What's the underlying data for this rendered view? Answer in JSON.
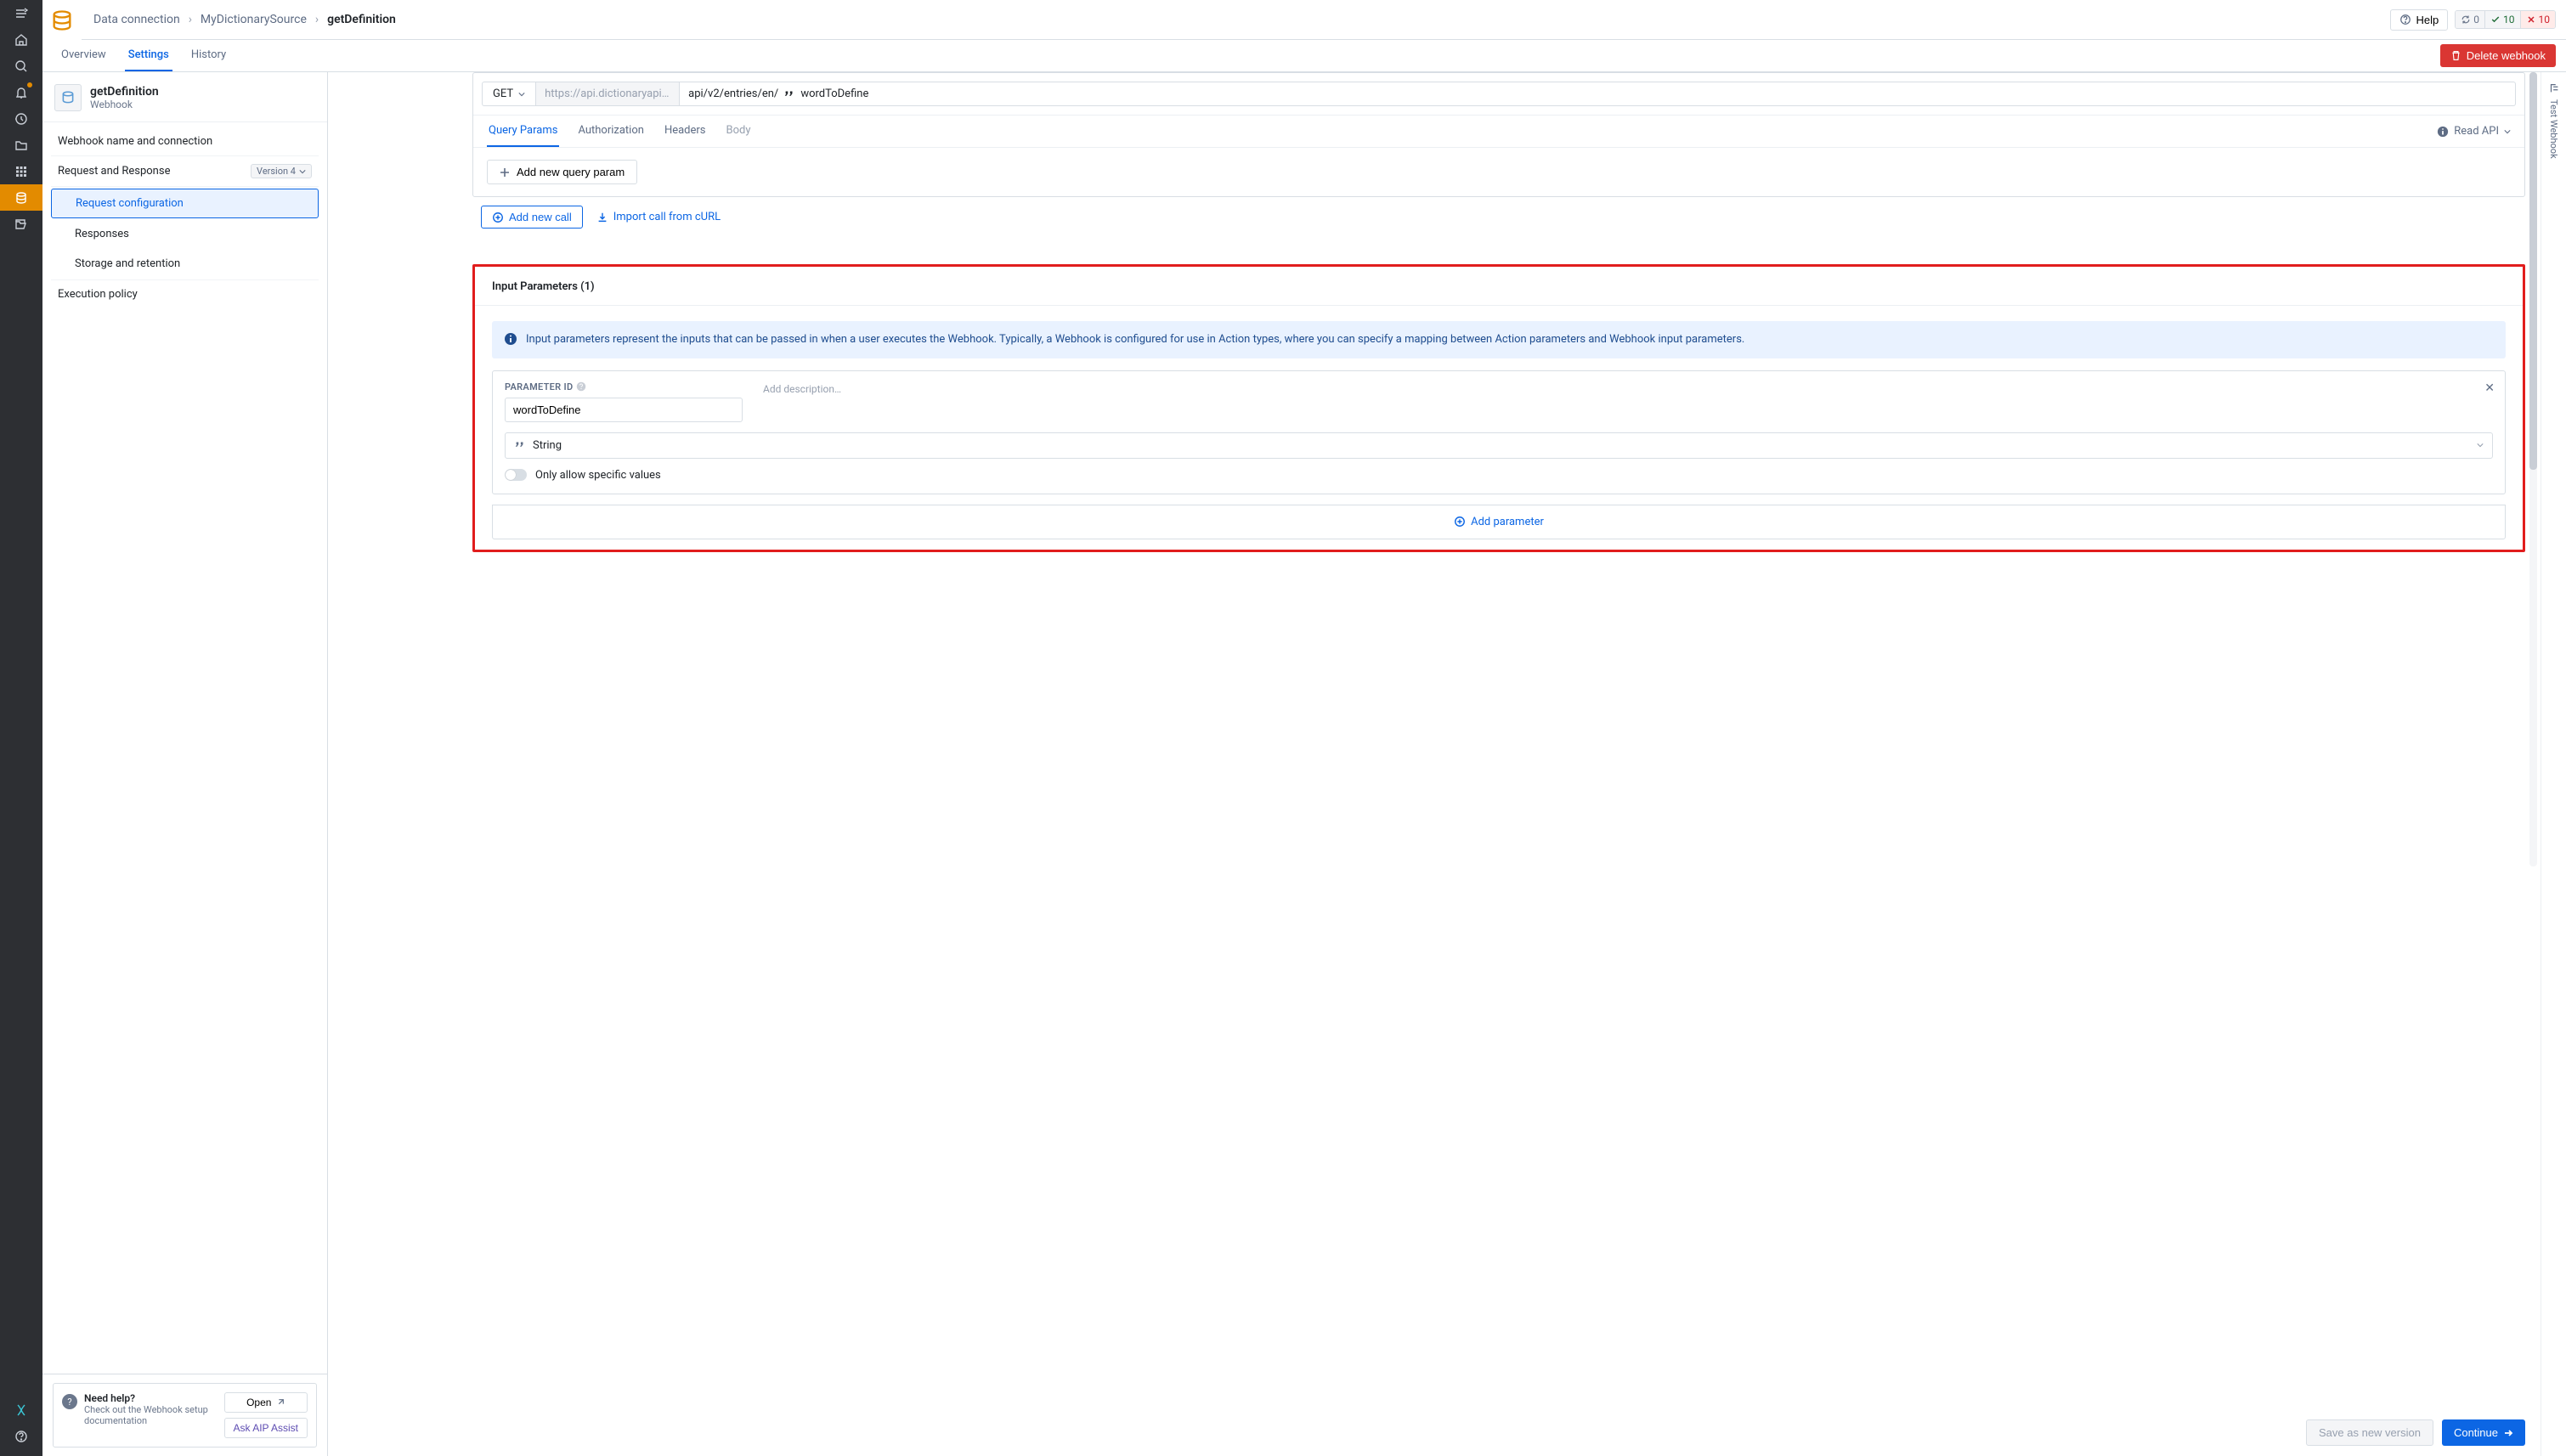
{
  "breadcrumb": {
    "root": "Data connection",
    "source": "MyDictionarySource",
    "leaf": "getDefinition"
  },
  "topbar": {
    "help": "Help",
    "refresh_count": "0",
    "ok_count": "10",
    "err_count": "10"
  },
  "tabs": {
    "overview": "Overview",
    "settings": "Settings",
    "history": "History"
  },
  "delete_label": "Delete webhook",
  "sidebar": {
    "title": "getDefinition",
    "subtitle": "Webhook",
    "items": {
      "name_conn": "Webhook name and connection",
      "req_resp": "Request and Response",
      "version": "Version 4",
      "request_config": "Request configuration",
      "responses": "Responses",
      "storage": "Storage and retention",
      "exec_policy": "Execution policy"
    },
    "help": {
      "title": "Need help?",
      "text": "Check out the Webhook setup documentation",
      "open": "Open",
      "assist": "Ask AIP Assist"
    }
  },
  "call": {
    "method": "GET",
    "base_url": "https://api.dictionaryapi....",
    "path_prefix": "api/v2/entries/en/",
    "path_var": "wordToDefine",
    "inner_tabs": {
      "query": "Query Params",
      "auth": "Authorization",
      "headers": "Headers",
      "body": "Body"
    },
    "read_api": "Read API",
    "add_query": "Add new query param",
    "add_call": "Add new call",
    "import_curl": "Import call from cURL"
  },
  "params": {
    "heading": "Input Parameters (1)",
    "info": "Input parameters represent the inputs that can be passed in when a user executes the Webhook. Typically, a Webhook is configured for use in Action types, where you can specify a mapping between Action parameters and Webhook input parameters.",
    "id_label": "PARAMETER ID",
    "id_value": "wordToDefine",
    "add_desc": "Add description…",
    "type": "String",
    "only_specific": "Only allow specific values",
    "add_param": "Add parameter"
  },
  "footer": {
    "save": "Save as new version",
    "continue": "Continue"
  },
  "right_rail": {
    "test": "Test Webhook"
  }
}
